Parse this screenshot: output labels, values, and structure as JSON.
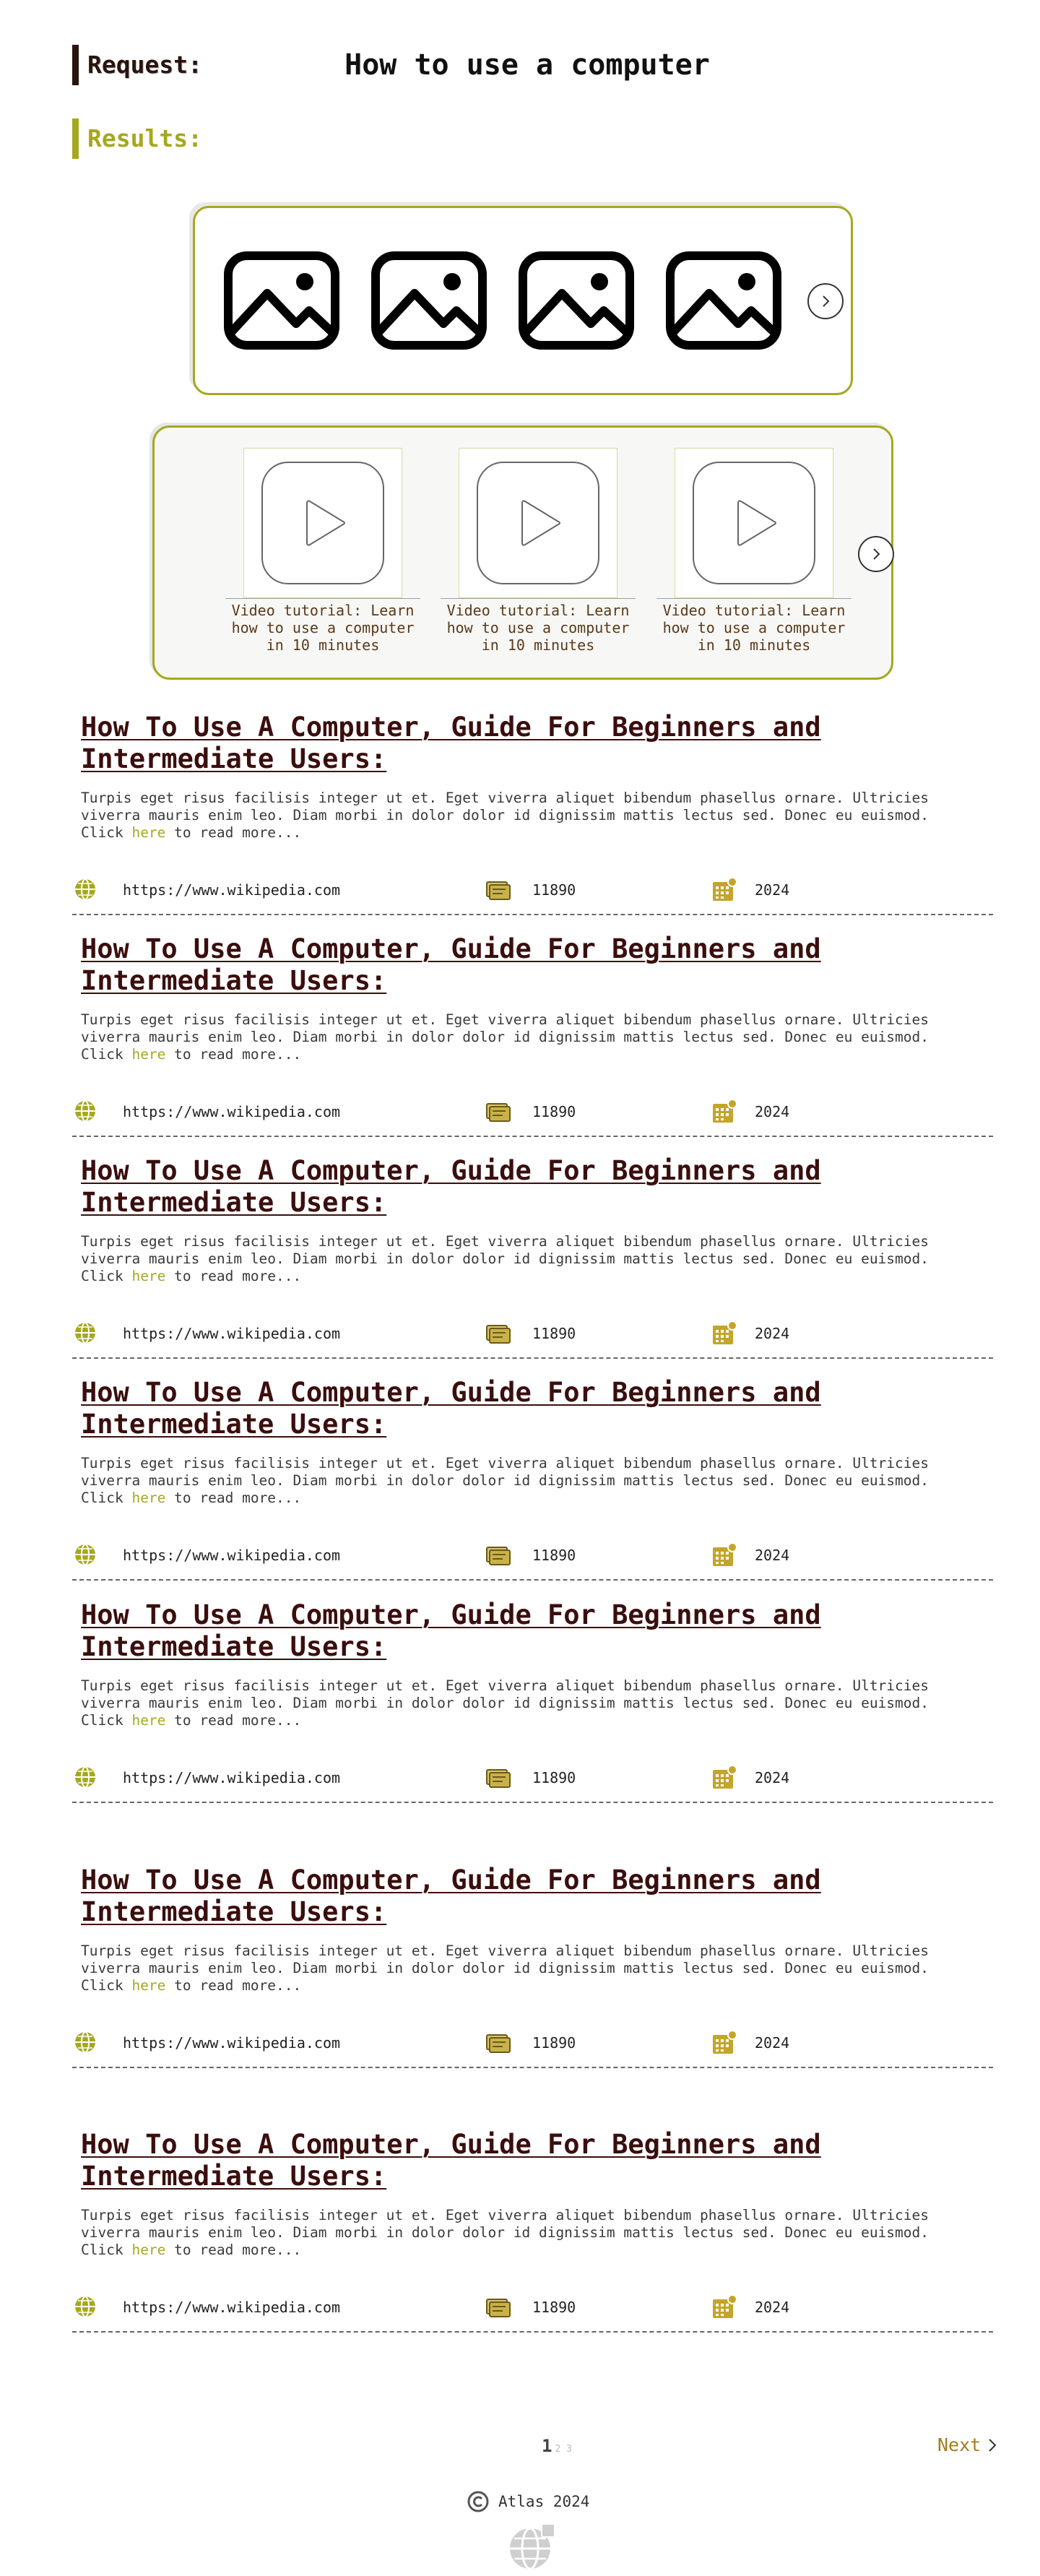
{
  "request": {
    "label": "Request:",
    "query": "How to use a computer"
  },
  "results_label": "Results:",
  "images": {
    "items": [
      "image-placeholder-icon",
      "image-placeholder-icon",
      "image-placeholder-icon",
      "image-placeholder-icon"
    ],
    "next_icon": "chevron-right-icon"
  },
  "videos": [
    {
      "caption": "Video tutorial: Learn how to use a computer in 10 minutes"
    },
    {
      "caption": "Video tutorial: Learn how to use a computer in 10 minutes"
    },
    {
      "caption": "Video tutorial: Learn how to use a computer in 10 minutes"
    }
  ],
  "results": [
    {
      "title": "How To Use A Computer, Guide For Beginners and Intermediate Users:",
      "snippet": "Turpis eget risus facilisis integer ut et. Eget viverra aliquet bibendum phasellus ornare. Ultricies viverra mauris enim leo. Diam morbi in dolor dolor id dignissim mattis lectus sed. Donec eu euismod. Click",
      "link_text": "here",
      "snippet_end": "to read more...",
      "url": "https://www.wikipedia.com",
      "views": "11890",
      "year": "2024"
    },
    {
      "title": "How To Use A Computer, Guide For Beginners and Intermediate Users:",
      "snippet": "Turpis eget risus facilisis integer ut et. Eget viverra aliquet bibendum phasellus ornare. Ultricies viverra mauris enim leo. Diam morbi in dolor dolor id dignissim mattis lectus sed. Donec eu euismod. Click",
      "link_text": "here",
      "snippet_end": "to read more...",
      "url": "https://www.wikipedia.com",
      "views": "11890",
      "year": "2024"
    },
    {
      "title": "How To Use A Computer, Guide For Beginners and Intermediate Users:",
      "snippet": "Turpis eget risus facilisis integer ut et. Eget viverra aliquet bibendum phasellus ornare. Ultricies viverra mauris enim leo. Diam morbi in dolor dolor id dignissim mattis lectus sed. Donec eu euismod. Click",
      "link_text": "here",
      "snippet_end": "to read more...",
      "url": "https://www.wikipedia.com",
      "views": "11890",
      "year": "2024"
    },
    {
      "title": "How To Use A Computer, Guide For Beginners and Intermediate Users:",
      "snippet": "Turpis eget risus facilisis integer ut et. Eget viverra aliquet bibendum phasellus ornare. Ultricies viverra mauris enim leo. Diam morbi in dolor dolor id dignissim mattis lectus sed. Donec eu euismod. Click",
      "link_text": "here",
      "snippet_end": "to read more...",
      "url": "https://www.wikipedia.com",
      "views": "11890",
      "year": "2024"
    },
    {
      "title": "How To Use A Computer, Guide For Beginners and Intermediate Users:",
      "snippet": "Turpis eget risus facilisis integer ut et. Eget viverra aliquet bibendum phasellus ornare. Ultricies viverra mauris enim leo. Diam morbi in dolor dolor id dignissim mattis lectus sed. Donec eu euismod. Click",
      "link_text": "here",
      "snippet_end": "to read more...",
      "url": "https://www.wikipedia.com",
      "views": "11890",
      "year": "2024"
    },
    {
      "title": "How To Use A Computer, Guide For Beginners and Intermediate Users:",
      "snippet": "Turpis eget risus facilisis integer ut et. Eget viverra aliquet bibendum phasellus ornare. Ultricies viverra mauris enim leo. Diam morbi in dolor dolor id dignissim mattis lectus sed. Donec eu euismod. Click",
      "link_text": "here",
      "snippet_end": "to read more...",
      "url": "https://www.wikipedia.com",
      "views": "11890",
      "year": "2024"
    },
    {
      "title": "How To Use A Computer, Guide For Beginners and Intermediate Users:",
      "snippet": "Turpis eget risus facilisis integer ut et. Eget viverra aliquet bibendum phasellus ornare. Ultricies viverra mauris enim leo. Diam morbi in dolor dolor id dignissim mattis lectus sed. Donec eu euismod. Click",
      "link_text": "here",
      "snippet_end": "to read more...",
      "url": "https://www.wikipedia.com",
      "views": "11890",
      "year": "2024"
    }
  ],
  "pagination": {
    "current": "1",
    "others": "2 3",
    "next_label": "Next"
  },
  "footer": {
    "copyright": "Atlas 2024",
    "copyright_icon": "copyright-icon",
    "logo_icon": "globe-logo-icon"
  },
  "colors": {
    "accent": "#a5a81e",
    "title": "#3b0e0e",
    "next": "#a57c1b"
  }
}
